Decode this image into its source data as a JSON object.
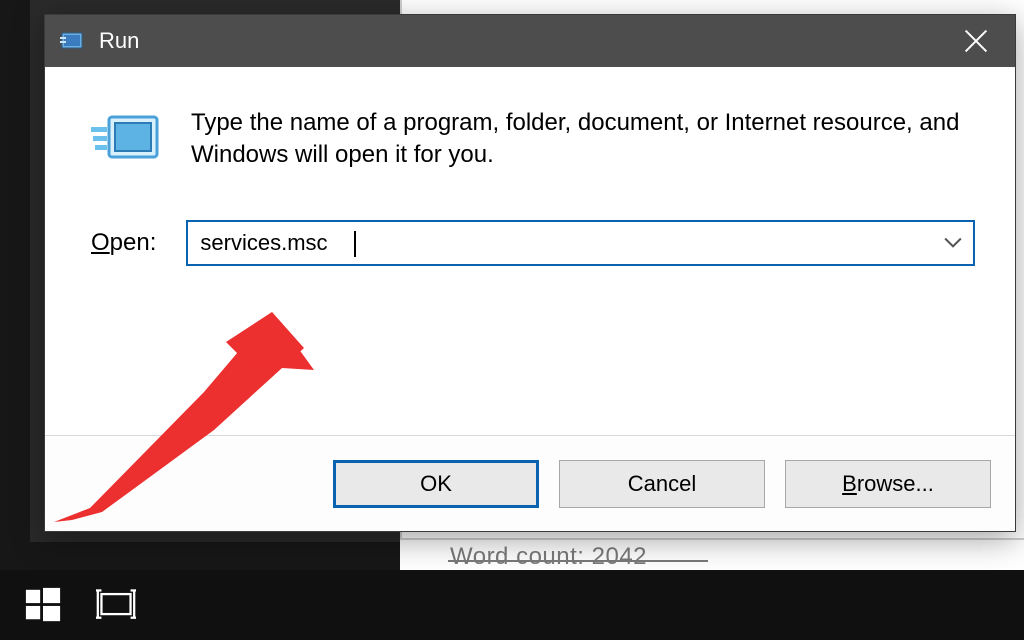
{
  "dialog": {
    "title": "Run",
    "description": "Type the name of a program, folder, document, or Internet resource, and Windows will open it for you.",
    "open_label_underline": "O",
    "open_label_rest": "pen:",
    "input_value": "services.msc",
    "buttons": {
      "ok": "OK",
      "cancel": "Cancel",
      "browse_underline": "B",
      "browse_rest": "rowse..."
    }
  },
  "background": {
    "word_count_text": "Word count: 2042"
  }
}
